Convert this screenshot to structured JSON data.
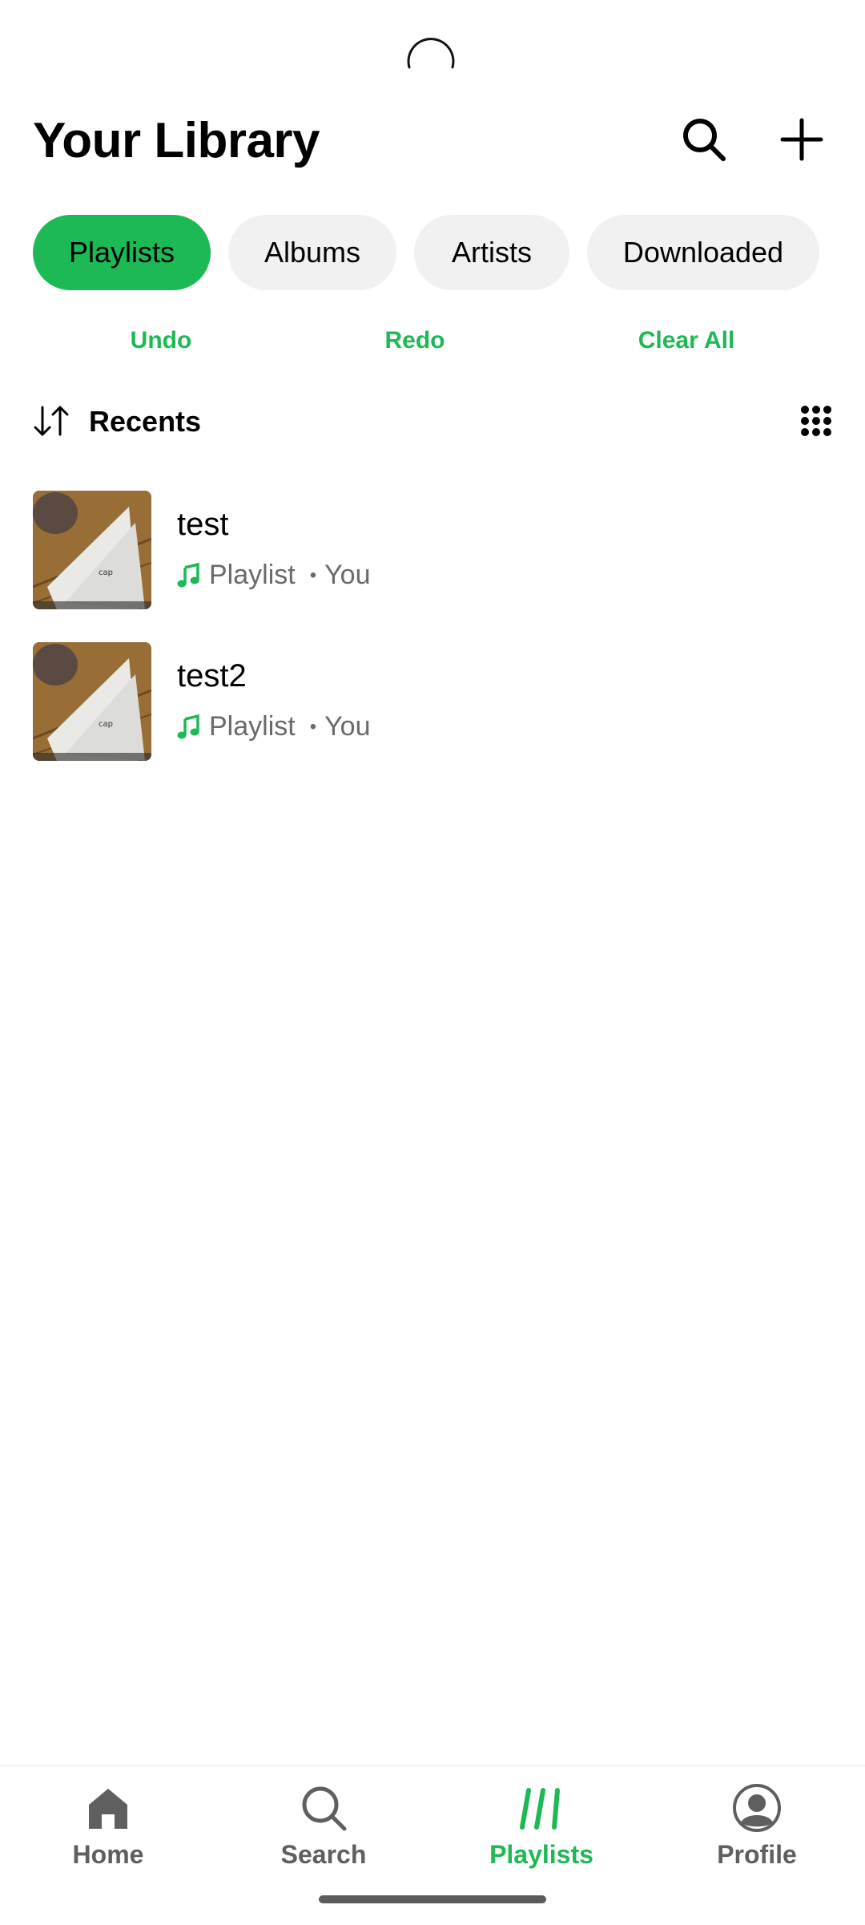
{
  "header": {
    "title": "Your Library"
  },
  "filters": [
    {
      "label": "Playlists",
      "active": true
    },
    {
      "label": "Albums",
      "active": false
    },
    {
      "label": "Artists",
      "active": false
    },
    {
      "label": "Downloaded",
      "active": false
    }
  ],
  "actions": {
    "undo": "Undo",
    "redo": "Redo",
    "clear_all": "Clear All"
  },
  "sort": {
    "label": "Recents"
  },
  "items": [
    {
      "title": "test",
      "type": "Playlist",
      "owner": "You"
    },
    {
      "title": "test2",
      "type": "Playlist",
      "owner": "You"
    }
  ],
  "nav": [
    {
      "label": "Home",
      "icon": "home-icon",
      "active": false
    },
    {
      "label": "Search",
      "icon": "search-icon",
      "active": false
    },
    {
      "label": "Playlists",
      "icon": "library-icon",
      "active": true
    },
    {
      "label": "Profile",
      "icon": "profile-icon",
      "active": false
    }
  ],
  "colors": {
    "accent": "#1db954",
    "chip_bg": "#f1f1f1",
    "text": "#000000",
    "muted": "#6a6a6a"
  }
}
